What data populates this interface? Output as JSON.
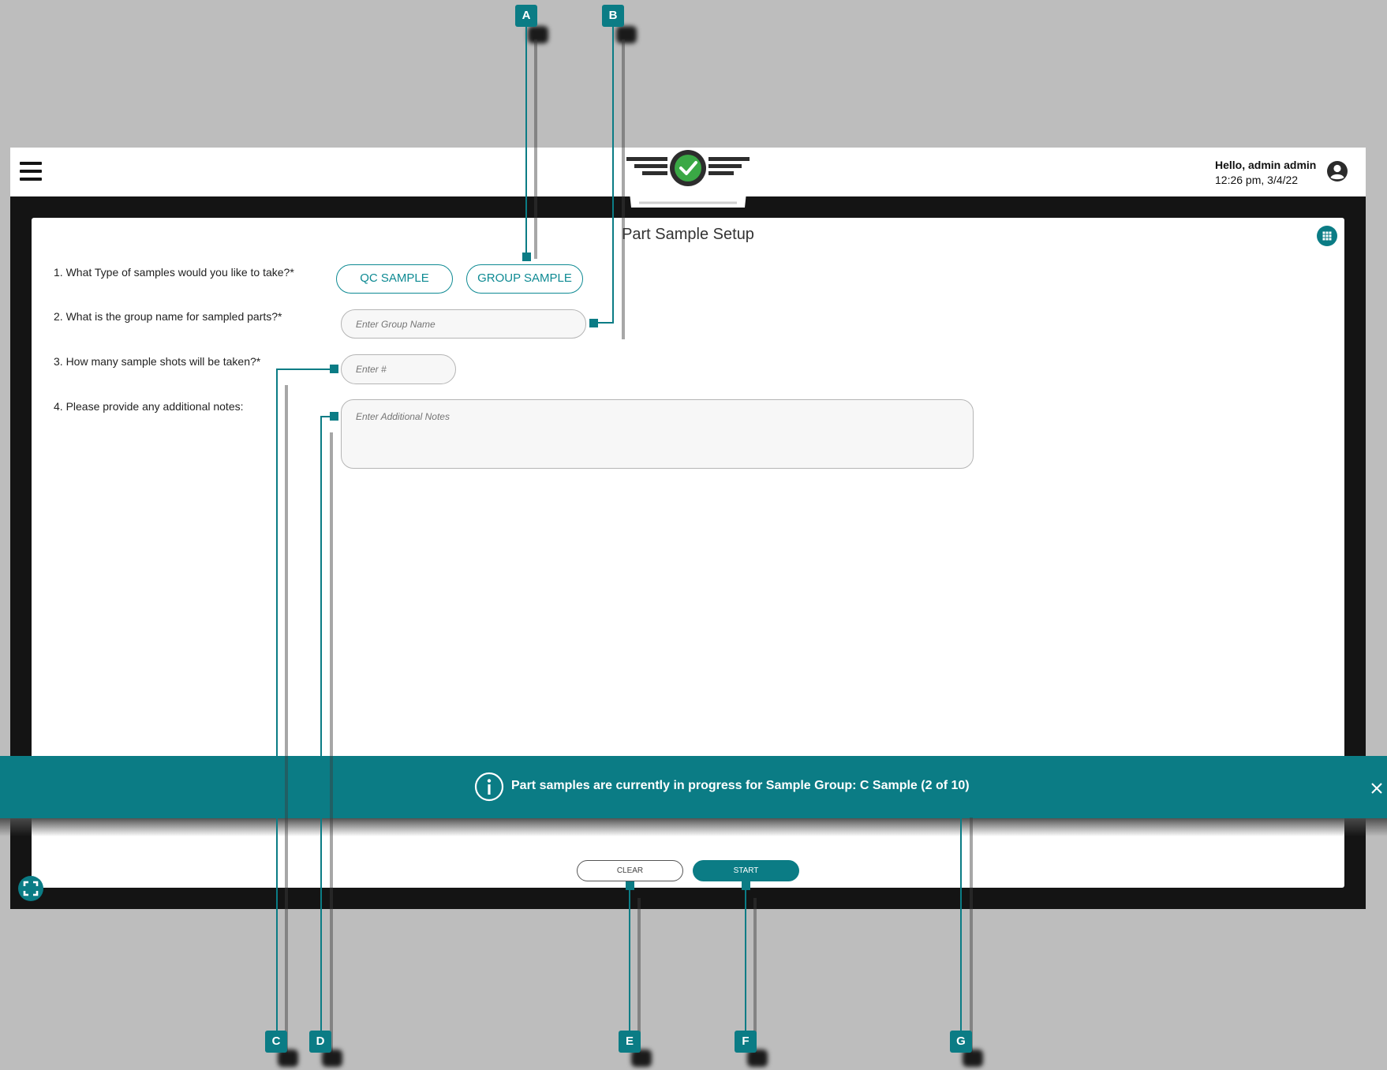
{
  "header": {
    "greeting": "Hello, admin admin",
    "datetime": "12:26 pm, 3/4/22"
  },
  "page": {
    "title": "Part Sample Setup"
  },
  "form": {
    "q1": "1. What Type of samples would you like to take?*",
    "q2": "2. What is the group name for sampled parts?*",
    "q3": "3. How many sample shots will be taken?*",
    "q4": "4. Please provide any additional notes:",
    "qc_sample_label": "QC SAMPLE",
    "group_sample_label": "GROUP SAMPLE",
    "group_name_placeholder": "Enter Group Name",
    "shots_placeholder": "Enter #",
    "notes_placeholder": "Enter Additional Notes"
  },
  "banner": {
    "message": "Part samples are currently in progress for Sample Group: C Sample (2 of 10)"
  },
  "footer": {
    "clear_label": "CLEAR",
    "start_label": "START"
  },
  "callouts": {
    "a": "A",
    "b": "B",
    "c": "C",
    "d": "D",
    "e": "E",
    "f": "F",
    "g": "G"
  },
  "colors": {
    "accent": "#0b7c85",
    "frame": "#141414",
    "background": "#bdbdbd",
    "logo_check": "#3aa845"
  },
  "icons": [
    "hamburger-menu-icon",
    "logo-icon",
    "user-account-icon",
    "grid-apps-icon",
    "info-icon",
    "close-icon",
    "fullscreen-icon"
  ]
}
